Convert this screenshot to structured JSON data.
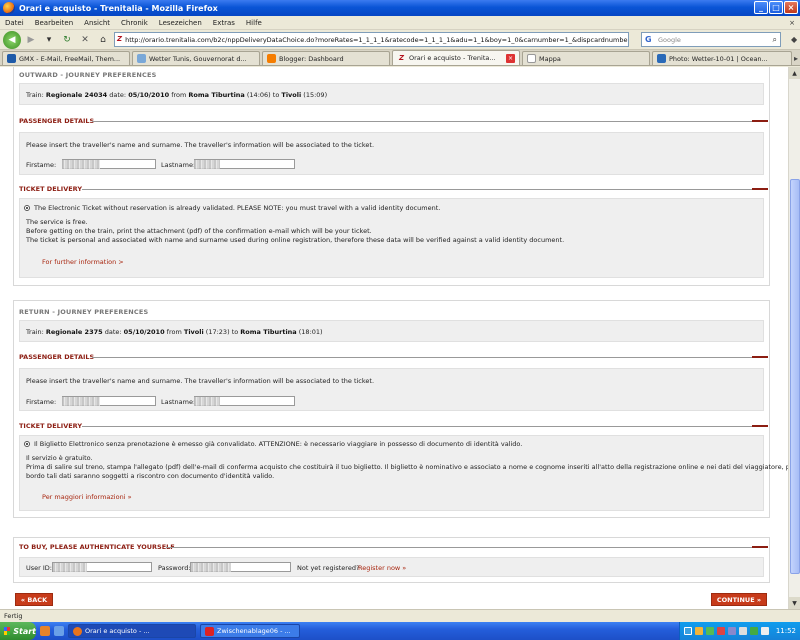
{
  "window": {
    "title": "Orari e acquisto - Trenitalia - Mozilla Firefox",
    "min": "_",
    "max": "□",
    "close": "×"
  },
  "menu": [
    "Datei",
    "Bearbeiten",
    "Ansicht",
    "Chronik",
    "Lesezeichen",
    "Extras",
    "Hilfe"
  ],
  "url": "http://orario.trenitalia.com/b2c/nppDeliveryDataChoice.do?moreRates=1_1_1_1&ratecode=1_1_1_1&adu=1_1&boy=1_0&carnumber=1_&dispcardnumber=&ch",
  "search_placeholder": "Google",
  "tabs": [
    {
      "label": "GMX - E-Mail, FreeMail, Them...",
      "color": "#1e5aa8"
    },
    {
      "label": "Wetter Tunis, Gouvernorat d...",
      "color": "#7aa8d8"
    },
    {
      "label": "Blogger: Dashboard",
      "color": "#f57d00"
    },
    {
      "label": "Orari e acquisto - Trenita...",
      "color": "#b3141f"
    },
    {
      "label": "Mappa",
      "color": "#ffffff"
    },
    {
      "label": "Photo: Wetter-10-01 | Ocean...",
      "color": "#2a6ab8"
    }
  ],
  "outward": {
    "title": "OUTWARD - JOURNEY PREFERENCES",
    "train_label": "Train:",
    "train": "Regionale 24034",
    "date_label": "date:",
    "date": "05/10/2010",
    "from_label": "from",
    "from": "Roma Tiburtina",
    "dep": "(14:06)",
    "to_label": "to",
    "to": "Tivoli",
    "arr": "(15:09)",
    "passenger_title": "PASSENGER DETAILS",
    "passenger_text": "Please insert the traveller's name and surname. The traveller's information will be associated to the ticket.",
    "firstname_label": "Firstame:",
    "lastname_label": "Lastname:",
    "delivery_title": "TICKET DELIVERY",
    "delivery_option": "The Electronic Ticket without reservation is already validated. PLEASE NOTE: you must travel with a valid identity document.",
    "line1": "The service is free.",
    "line2": "Before getting on the train, print the attachment (pdf) of the confirmation e-mail which will be your ticket.",
    "line3": "The ticket is personal and associated with name and surname used during online registration, therefore these data will be verified against a valid identity document.",
    "info_link": "For further information >"
  },
  "return": {
    "title": "RETURN - JOURNEY PREFERENCES",
    "train_label": "Train:",
    "train": "Regionale 2375",
    "date_label": "date:",
    "date": "05/10/2010",
    "from_label": "from",
    "from": "Tivoli",
    "dep": "(17:23)",
    "to_label": "to",
    "to": "Roma Tiburtina",
    "arr": "(18:01)",
    "passenger_title": "PASSENGER DETAILS",
    "passenger_text": "Please insert the traveller's name and surname. The traveller's information will be associated to the ticket.",
    "firstname_label": "Firstame:",
    "lastname_label": "Lastname:",
    "delivery_title": "TICKET DELIVERY",
    "delivery_option": "Il Biglietto Elettronico senza prenotazione è emesso già convalidato. ATTENZIONE: è necessario viaggiare in possesso di documento di identità valido.",
    "line1": "Il servizio è gratuito.",
    "line2": "Prima di salire sul treno, stampa l'allegato (pdf) dell'e-mail di conferma acquisto che costituirà il tuo biglietto. Il biglietto è nominativo e associato a nome e cognome inseriti all'atto della registrazione online e nei dati del viaggiatore, pertanto a",
    "line3": "bordo tali dati saranno soggetti a riscontro con documento d'identità valido.",
    "info_link": "Per maggiori informazioni »"
  },
  "auth": {
    "title": "TO BUY, PLEASE AUTHENTICATE YOURSELF",
    "user_label": "User ID:",
    "password_label": "Password:",
    "not_registered": "Not yet registered?",
    "register_link": "Register now »"
  },
  "buttons": {
    "back": "« BACK",
    "continue": "CONTINUE »"
  },
  "status": "Fertig",
  "taskbar": {
    "start": "Start",
    "items": [
      "Orari e acquisto - ...",
      "Zwischenablage06 - ..."
    ],
    "clock": "11:52"
  },
  "colors": {
    "accent_red": "#8c1d12",
    "button_red": "#c73b1a"
  }
}
